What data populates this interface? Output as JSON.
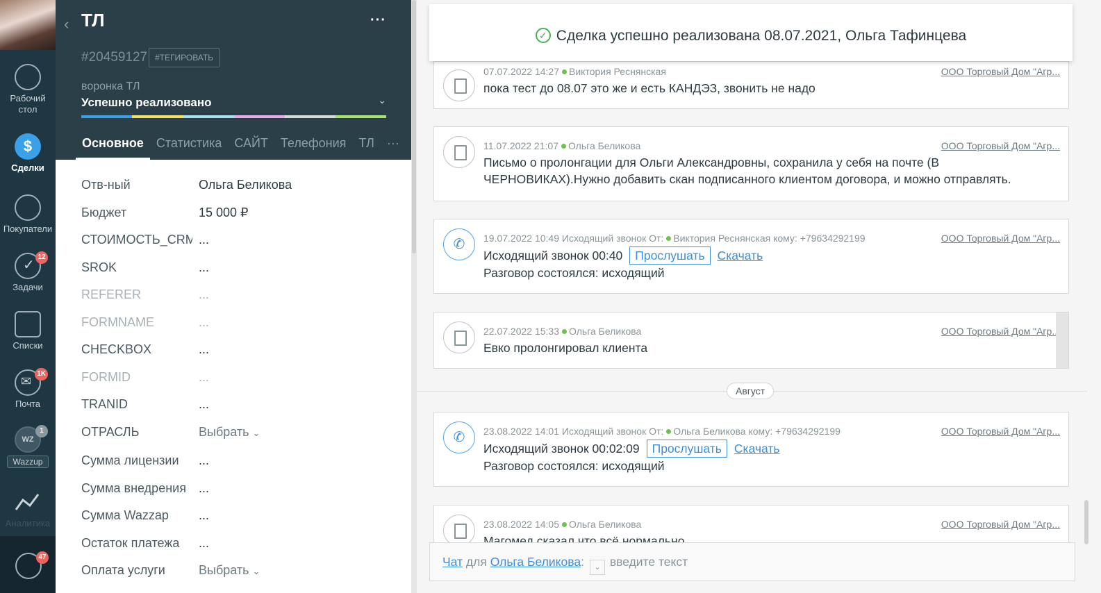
{
  "nav": {
    "items": [
      {
        "label": "Рабочий стол",
        "icon": "dashboard-icon"
      },
      {
        "label": "Сделки",
        "icon": "deals-icon"
      },
      {
        "label": "Покупатели",
        "icon": "customers-icon"
      },
      {
        "label": "Задачи",
        "icon": "tasks-icon",
        "badge": "12"
      },
      {
        "label": "Списки",
        "icon": "lists-icon"
      },
      {
        "label": "Почта",
        "icon": "mail-icon",
        "badge": "1K"
      },
      {
        "label": "Wazzup",
        "icon": "wazzup-icon",
        "badge": "1",
        "logo": "WZ"
      },
      {
        "label": "Аналитика",
        "icon": "analytics-icon"
      }
    ],
    "chat_badge": "47"
  },
  "card": {
    "title": "ТЛ",
    "more": "···",
    "deal_id": "#20459127",
    "tag_button": "#ТЕГИРОВАТЬ",
    "funnel_label": "воронка ТЛ",
    "funnel_value": "Успешно реализовано",
    "progress_colors": [
      "#3aa0e8",
      "#f5e063",
      "#a8e0f0",
      "#e7a9e8",
      "#d8d8d8",
      "#a6e36a"
    ],
    "tabs": [
      "Основное",
      "Статистика",
      "САЙТ",
      "Телефония",
      "ТЛ",
      "···"
    ]
  },
  "fields": [
    {
      "name": "Отв-ный",
      "value": "Ольга Беликова"
    },
    {
      "name": "Бюджет",
      "value": "15 000  ₽"
    },
    {
      "name": "СТОИМОСТЬ_CRM",
      "value": "..."
    },
    {
      "name": "SROK",
      "value": "..."
    },
    {
      "name": "REFERER",
      "value": "..."
    },
    {
      "name": "FORMNAME",
      "value": "..."
    },
    {
      "name": "CHECKBOX",
      "value": "..."
    },
    {
      "name": "FORMID",
      "value": "..."
    },
    {
      "name": "TRANID",
      "value": "..."
    },
    {
      "name": "ОТРАСЛЬ",
      "value": "Выбрать"
    },
    {
      "name": "Сумма лицензии",
      "value": "..."
    },
    {
      "name": "Сумма внедрения",
      "value": "..."
    },
    {
      "name": "Сумма Wazzap",
      "value": "..."
    },
    {
      "name": "Остаток платежа",
      "value": "..."
    },
    {
      "name": "Оплата услуги",
      "value": "Выбрать"
    }
  ],
  "feed": {
    "notice": "Сделка успешно реализована 08.07.2021, Ольга Тафинцева",
    "company": "ООО Торговый Дом \"Агр...",
    "notes": [
      {
        "meta": "07.07.2022 14:27",
        "author": "Виктория Реснянская",
        "text": "пока тест до 08.07 это же и есть КАНДЭЗ, звонить не надо"
      },
      {
        "meta": "11.07.2022 21:07",
        "author": "Ольга Беликова",
        "text": "Письмо о пролонгации для Ольги Александровны, сохранила у себя на почте (В ЧЕРНОВИКАХ).Нужно добавить скан подписанного клиентом договора, и можно отправлять."
      },
      {
        "meta": "19.07.2022 10:49 Исходящий звонок От:",
        "author": "Виктория Реснянская кому: +79634292199",
        "text": "Исходящий звонок 00:40",
        "listen": "Прослушать",
        "download": "Скачать",
        "result": "Разговор состоялся: исходящий"
      },
      {
        "meta": "22.07.2022 15:33",
        "author": "Ольга Беликова",
        "text": "Евко пролонгировал клиента"
      },
      {
        "meta": "23.08.2022 14:01 Исходящий звонок От:",
        "author": "Ольга Беликова кому: +79634292199",
        "text": "Исходящий звонок 00:02:09",
        "listen": "Прослушать",
        "download": "Скачать",
        "result": "Разговор состоялся: исходящий"
      },
      {
        "meta": "23.08.2022 14:05",
        "author": "Ольга Беликова",
        "text": "Магомед сказал что всё нормально"
      }
    ],
    "month_divider": "Август"
  },
  "chat": {
    "chat_link": "Чат",
    "for": "для",
    "recipient": "Ольга Беликова",
    "colon": ":",
    "placeholder": "введите текст"
  }
}
